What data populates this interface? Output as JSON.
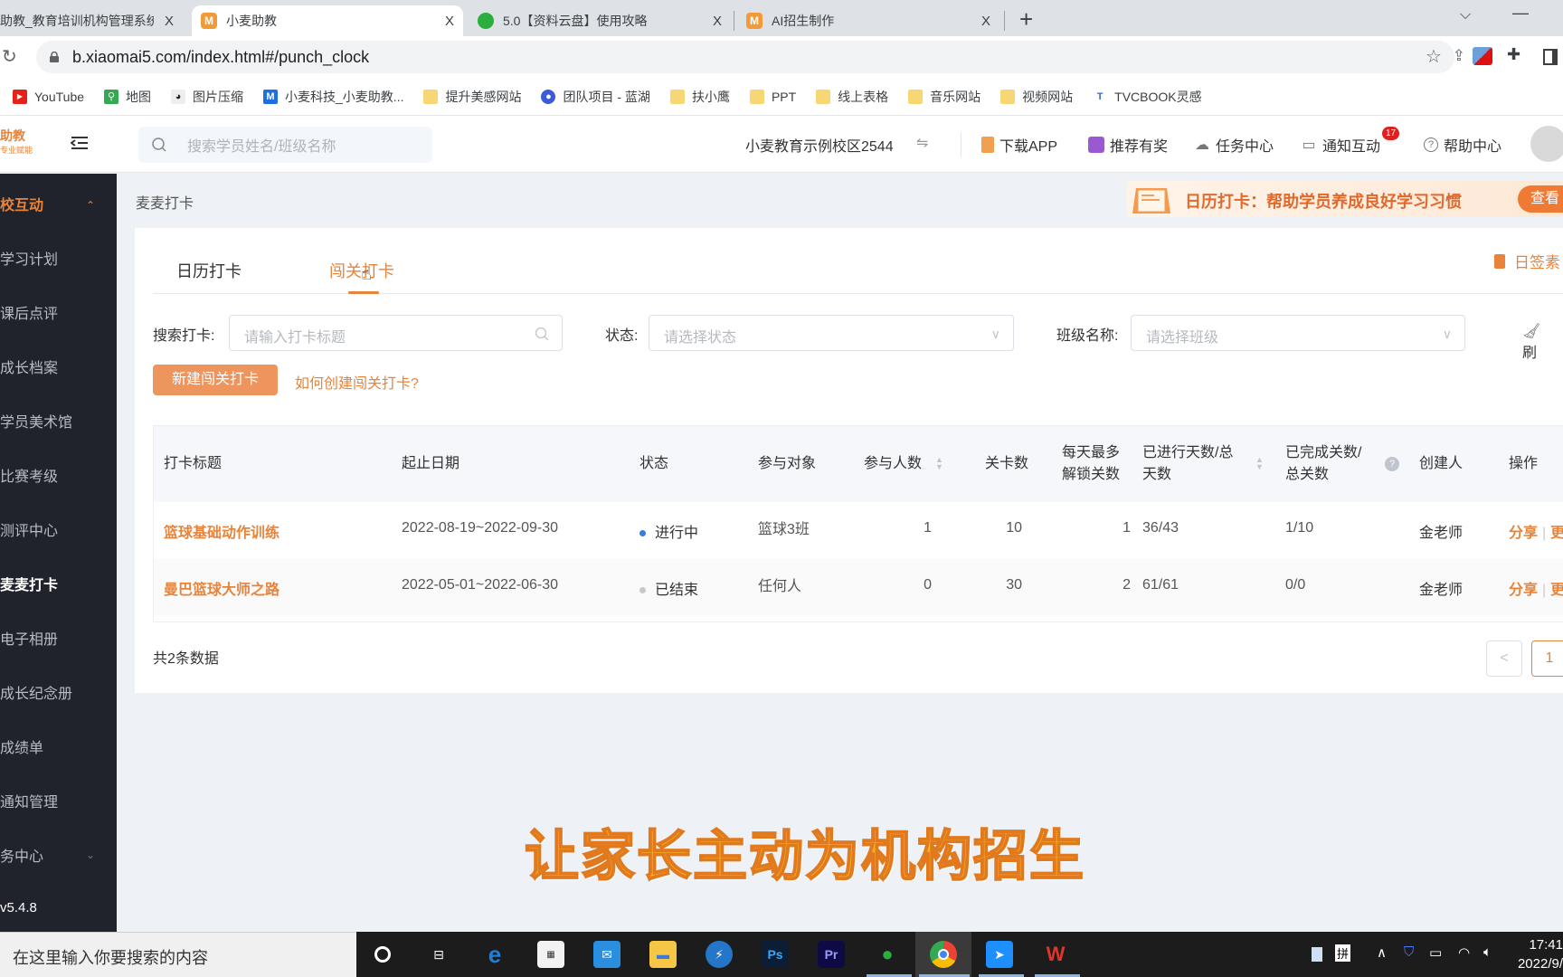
{
  "browser": {
    "tabs": [
      {
        "title": "助教_教育培训机构管理系统",
        "favicon": "xiaomai-icon",
        "active": false
      },
      {
        "title": "小麦助教",
        "favicon": "xiaomai-icon",
        "active": true
      },
      {
        "title": "5.0【资料云盘】使用攻略",
        "favicon": "wechat-icon",
        "active": false
      },
      {
        "title": "AI招生制作",
        "favicon": "xiaomai-icon",
        "active": false
      }
    ],
    "new_tab": "+",
    "close": "X",
    "url": "b.xiaomai5.com/index.html#/punch_clock",
    "bookmarks": [
      {
        "label": "YouTube",
        "icon": "youtube-icon"
      },
      {
        "label": "地图",
        "icon": "maps-icon"
      },
      {
        "label": "图片压缩",
        "icon": "panda-icon"
      },
      {
        "label": "小麦科技_小麦助教...",
        "icon": "xiaomai-m-icon"
      },
      {
        "label": "提升美感网站",
        "icon": "folder-icon"
      },
      {
        "label": "团队项目 - 蓝湖",
        "icon": "lanhu-icon"
      },
      {
        "label": "扶小鹰",
        "icon": "folder-icon"
      },
      {
        "label": "PPT",
        "icon": "folder-icon"
      },
      {
        "label": "线上表格",
        "icon": "folder-icon"
      },
      {
        "label": "音乐网站",
        "icon": "folder-icon"
      },
      {
        "label": "视频网站",
        "icon": "folder-icon"
      },
      {
        "label": "TVCBOOK灵感",
        "icon": "tvcbook-icon"
      }
    ]
  },
  "header": {
    "logo": "助教",
    "logo_sub": "专业赋能",
    "search_placeholder": "搜索学员姓名/班级名称",
    "campus": "小麦教育示例校区2544",
    "campus_switch": "⇋",
    "download_app": "下载APP",
    "referral": "推荐有奖",
    "task_center": "任务中心",
    "notifications": "通知互动",
    "notification_count": "17",
    "help": "帮助中心"
  },
  "sidebar": {
    "group": "校互动",
    "items": [
      "学习计划",
      "课后点评",
      "成长档案",
      "学员美术馆",
      "比赛考级",
      "测评中心",
      "麦麦打卡",
      "电子相册",
      "成长纪念册",
      "成绩单",
      "通知管理"
    ],
    "active": "麦麦打卡",
    "collapsed_group": "务中心",
    "version": "v5.4.8"
  },
  "content": {
    "breadcrumb": "麦麦打卡",
    "promo_text": "日历打卡：帮助学员养成良好学习习惯",
    "promo_button": "查看",
    "tabs": [
      {
        "label": "日历打卡",
        "active": false
      },
      {
        "label": "闯关打卡",
        "active": true
      }
    ],
    "sign_link": "日签素",
    "filters": {
      "search_label": "搜索打卡:",
      "search_placeholder": "请输入打卡标题",
      "status_label": "状态:",
      "status_placeholder": "请选择状态",
      "class_label": "班级名称:",
      "class_placeholder": "请选择班级",
      "reset": "刷"
    },
    "new_button": "新建闯关打卡",
    "how_link": "如何创建闯关打卡?",
    "table": {
      "headers": [
        "打卡标题",
        "起止日期",
        "状态",
        "参与对象",
        "参与人数",
        "关卡数",
        "每天最多解锁关数",
        "已进行天数/总天数",
        "已完成关数/总关数",
        "创建人",
        "操作"
      ],
      "rows": [
        {
          "title": "篮球基础动作训练",
          "dates": "2022-08-19~2022-09-30",
          "status": "进行中",
          "status_color": "#2f7fe0",
          "target": "篮球3班",
          "participants": "1",
          "levels": "10",
          "daily_unlock": "1",
          "days": "36/43",
          "completed": "1/10",
          "creator": "金老师",
          "actions": [
            "分享",
            "更"
          ]
        },
        {
          "title": "曼巴篮球大师之路",
          "dates": "2022-05-01~2022-06-30",
          "status": "已结束",
          "status_color": "#c8c8c8",
          "target": "任何人",
          "participants": "0",
          "levels": "30",
          "daily_unlock": "2",
          "days": "61/61",
          "completed": "0/0",
          "creator": "金老师",
          "actions": [
            "分享",
            "更"
          ]
        }
      ]
    },
    "total": "共2条数据",
    "pagination": {
      "prev": "<",
      "current": "1"
    }
  },
  "subtitle": "让家长主动为机构招生",
  "taskbar": {
    "search_placeholder": "在这里输入你要搜索的内容",
    "apps": [
      "cortana-icon",
      "task-view-icon",
      "edge-icon",
      "store-icon",
      "mail-icon",
      "explorer-icon",
      "thunder-icon",
      "photoshop-icon",
      "premiere-icon",
      "wechat-icon",
      "chrome-icon",
      "feishu-icon",
      "wps-icon"
    ],
    "ime": "拼",
    "time": "17:41",
    "date": "2022/9/"
  },
  "colors": {
    "accent": "#e8833a",
    "sidebar_bg": "#20232b"
  }
}
